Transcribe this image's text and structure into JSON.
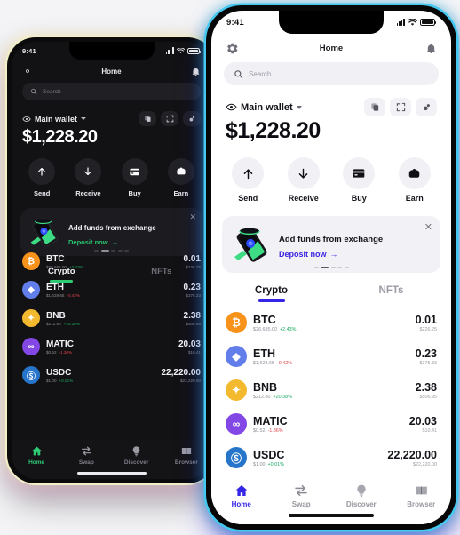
{
  "app": {
    "status_bar": {
      "time": "9:41"
    },
    "header": {
      "title": "Home",
      "settings_icon": "gear-icon",
      "notification_icon": "bell-icon"
    },
    "search": {
      "placeholder": "Search",
      "icon": "search-icon"
    },
    "wallet": {
      "name": "Main wallet",
      "eye_icon": "eye-icon",
      "balance": "$1,228.20",
      "actions": [
        {
          "name": "copy-address-button",
          "icon": "copy-icon"
        },
        {
          "name": "scan-qr-button",
          "icon": "scan-icon"
        },
        {
          "name": "connections-button",
          "icon": "link-icon"
        }
      ]
    },
    "quick_actions": [
      {
        "label": "Send",
        "icon": "arrow-up-icon"
      },
      {
        "label": "Receive",
        "icon": "arrow-down-icon"
      },
      {
        "label": "Buy",
        "icon": "credit-card-icon"
      },
      {
        "label": "Earn",
        "icon": "piggy-bank-icon"
      }
    ],
    "promo": {
      "title": "Add funds from exchange",
      "link": "Deposit now",
      "link_arrow": "→",
      "close_icon": "close-icon",
      "dots_total": 5,
      "dots_active_index": 1
    },
    "tabs": [
      {
        "label": "Crypto",
        "active": true
      },
      {
        "label": "NFTs",
        "active": false
      }
    ],
    "assets": [
      {
        "symbol": "BTC",
        "glyph": "₿",
        "color": "#F7931A",
        "price": "$26,685.00",
        "change": "+2.43%",
        "direction": "up",
        "amount": "0.01",
        "usd": "$226.25"
      },
      {
        "symbol": "ETH",
        "glyph": "◆",
        "color": "#627EEA",
        "price": "$1,628.65",
        "change": "-0.42%",
        "direction": "down",
        "amount": "0.23",
        "usd": "$375.33"
      },
      {
        "symbol": "BNB",
        "glyph": "✦",
        "color": "#F3BA2F",
        "price": "$212.80",
        "change": "+20.38%",
        "direction": "up",
        "amount": "2.38",
        "usd": "$506.95"
      },
      {
        "symbol": "MATIC",
        "glyph": "∞",
        "color": "#8247E5",
        "price": "$0.52",
        "change": "-1.36%",
        "direction": "down",
        "amount": "20.03",
        "usd": "$10.41"
      },
      {
        "symbol": "USDC",
        "glyph": "Ⓢ",
        "color": "#2775CA",
        "price": "$1.00",
        "change": "+0.01%",
        "direction": "up",
        "amount": "22,220.00",
        "usd": "$22,220.00"
      }
    ],
    "bottom_nav": [
      {
        "label": "Home",
        "icon": "home-icon",
        "active": true
      },
      {
        "label": "Swap",
        "icon": "swap-icon",
        "active": false
      },
      {
        "label": "Discover",
        "icon": "bulb-icon",
        "active": false
      },
      {
        "label": "Browser",
        "icon": "browser-icon",
        "active": false
      }
    ]
  },
  "theme": {
    "dark_accent": "#2fcb74",
    "light_accent": "#3525e6",
    "dark_bg": "#121214",
    "light_bg": "#ffffff",
    "light_rim": "#45c8f0"
  }
}
